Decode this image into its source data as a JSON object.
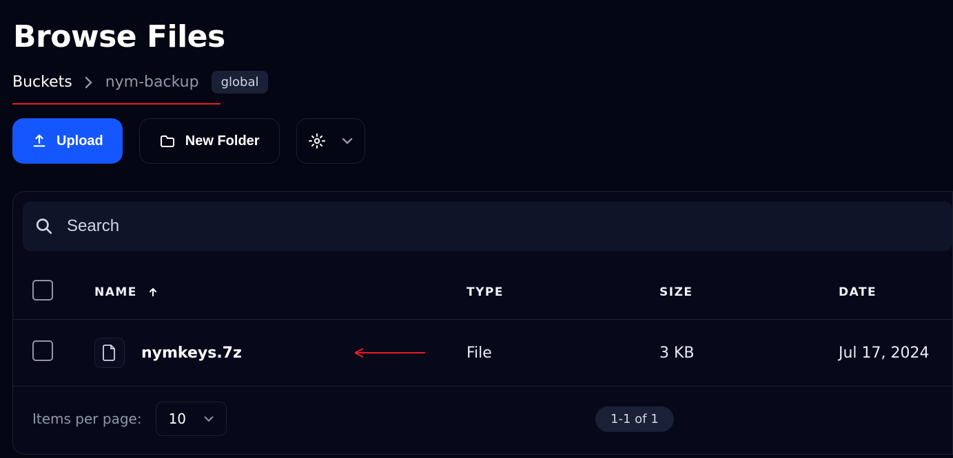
{
  "title": "Browse Files",
  "breadcrumbs": {
    "root": "Buckets",
    "leaf": "nym-backup",
    "badge": "global"
  },
  "toolbar": {
    "upload_label": "Upload",
    "newfolder_label": "New Folder"
  },
  "search": {
    "placeholder": "Search"
  },
  "columns": {
    "name": "NAME",
    "type": "TYPE",
    "size": "SIZE",
    "date": "DATE"
  },
  "rows": [
    {
      "name": "nymkeys.7z",
      "type": "File",
      "size": "3 KB",
      "date": "Jul 17, 2024"
    }
  ],
  "footer": {
    "items_per_page_label": "Items per page:",
    "items_per_page_value": "10",
    "range": "1-1 of 1"
  },
  "colors": {
    "accent": "#1457ff",
    "annotation": "#ea1b27"
  }
}
